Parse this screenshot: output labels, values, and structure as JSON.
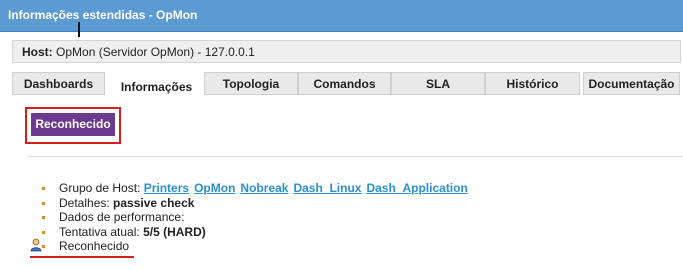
{
  "window": {
    "title": "Informações estendidas - OpMon"
  },
  "host": {
    "label": "Host:",
    "value": "OpMon (Servidor OpMon) - 127.0.0.1"
  },
  "tabs": [
    {
      "label": "Dashboards"
    },
    {
      "label": "Informações",
      "active": true
    },
    {
      "label": "Topologia"
    },
    {
      "label": "Comandos"
    },
    {
      "label": "SLA"
    },
    {
      "label": "Histórico"
    },
    {
      "label": "Documentação"
    }
  ],
  "actions": {
    "acknowledged_button": "Reconhecido"
  },
  "details": {
    "host_group_label": "Grupo de Host:",
    "host_groups": [
      "Printers",
      "OpMon",
      "Nobreak",
      "Dash_Linux",
      "Dash_Application"
    ],
    "details_label": "Detalhes:",
    "details_value": "passive check",
    "perf_label": "Dados de performance:",
    "attempt_label": "Tentativa atual:",
    "attempt_value": "5/5 (HARD)",
    "ack_label": "Reconhecido"
  },
  "colors": {
    "titlebar": "#5b9ad2",
    "button": "#6b3a8e",
    "highlight": "#d21f1f",
    "link": "#2b8fd1",
    "bullet": "#e08a25"
  },
  "icons": {
    "ack": "user-icon"
  }
}
